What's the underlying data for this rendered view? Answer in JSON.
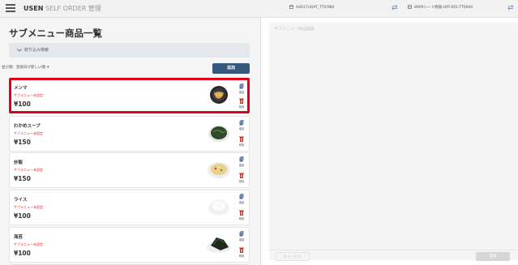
{
  "header": {
    "brand_bold": "USEN",
    "brand_rest": " SELF ORDER 管理",
    "store_icon": "store-icon",
    "store_label": "A4017UOAT_TT0/980",
    "swap_icon": "swap-arrows-icon",
    "seat_icon": "seat-icon",
    "seat_label": "8909シート情報-UAT-001-TT0940"
  },
  "left": {
    "title": "サブメニュー商品一覧",
    "filter_label": "絞り込み検索",
    "sort_label": "並び順：",
    "sort_value": "登録日が新しい順",
    "add_button": "追加",
    "items": [
      {
        "name": "メンマ",
        "tag": "サブメニュー未設定",
        "price": "¥100",
        "image": "menma-dish",
        "copy_label": "複製",
        "delete_label": "削除"
      },
      {
        "name": "わかめスープ",
        "tag": "サブメニュー未設定",
        "price": "¥150",
        "image": "wakame-soup-dish",
        "copy_label": "複製",
        "delete_label": "削除"
      },
      {
        "name": "炒飯",
        "tag": "サブメニュー未設定",
        "price": "¥150",
        "image": "fried-rice-dish",
        "copy_label": "複製",
        "delete_label": "削除"
      },
      {
        "name": "ライス",
        "tag": "サブメニュー未設定",
        "price": "¥100",
        "image": "rice-dish",
        "copy_label": "複製",
        "delete_label": "削除"
      },
      {
        "name": "海苔",
        "tag": "サブメニュー未設定",
        "price": "¥100",
        "image": "nori-dish",
        "copy_label": "複製",
        "delete_label": "削除"
      }
    ]
  },
  "right": {
    "title": "サブメニュー商品編集",
    "cancel_button": "キャンセル",
    "register_button": "登録"
  },
  "colors": {
    "accent": "#36587c",
    "selected_border": "#e0001a",
    "tag_red": "#d22222",
    "copy_icon": "#4a6b8f",
    "delete_icon": "#c0392b"
  }
}
